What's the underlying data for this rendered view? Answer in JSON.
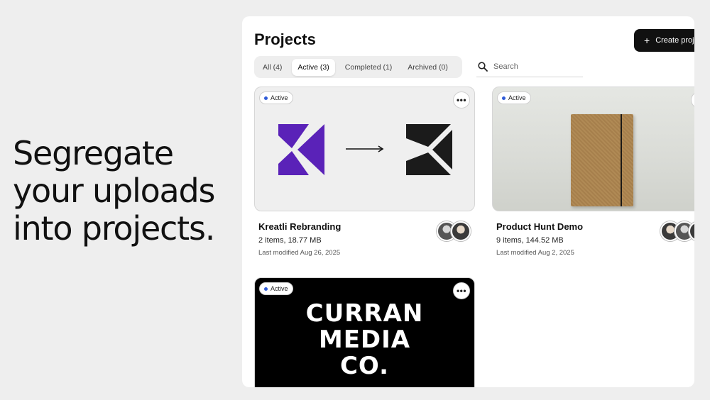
{
  "tagline": "Segregate\nyour uploads\ninto projects.",
  "header": {
    "title": "Projects",
    "create_label": "Create proj"
  },
  "tabs": [
    {
      "label": "All (4)"
    },
    {
      "label": "Active (3)",
      "active": true
    },
    {
      "label": "Completed (1)"
    },
    {
      "label": "Archived (0)"
    }
  ],
  "search": {
    "placeholder": "Search",
    "value": ""
  },
  "projects": [
    {
      "status": "Active",
      "name": "Kreatli Rebranding",
      "meta": "2 items, 18.77 MB",
      "modified": "Last modified Aug 26, 2025",
      "thumbnail": "logo-transition",
      "colors": {
        "old_logo": "#5a22b8",
        "new_logo": "#1b1b1b"
      }
    },
    {
      "status": "Active",
      "name": "Product Hunt Demo",
      "meta": "9 items, 144.52 MB",
      "modified": "Last modified Aug 2, 2025",
      "thumbnail": "notebook-photo"
    },
    {
      "status": "Active",
      "thumbnail_text": "CURRAN\nMEDIA\nCO.",
      "thumbnail": "curran-logo"
    }
  ],
  "icons": {
    "search": "search-icon",
    "more": "more-icon",
    "add": "plus-icon"
  },
  "more_glyph": "•••",
  "colors": {
    "accent": "#111111",
    "status_dot": "#2f5bd8",
    "panel_bg": "#ffffff",
    "page_bg": "#eeeeee"
  }
}
